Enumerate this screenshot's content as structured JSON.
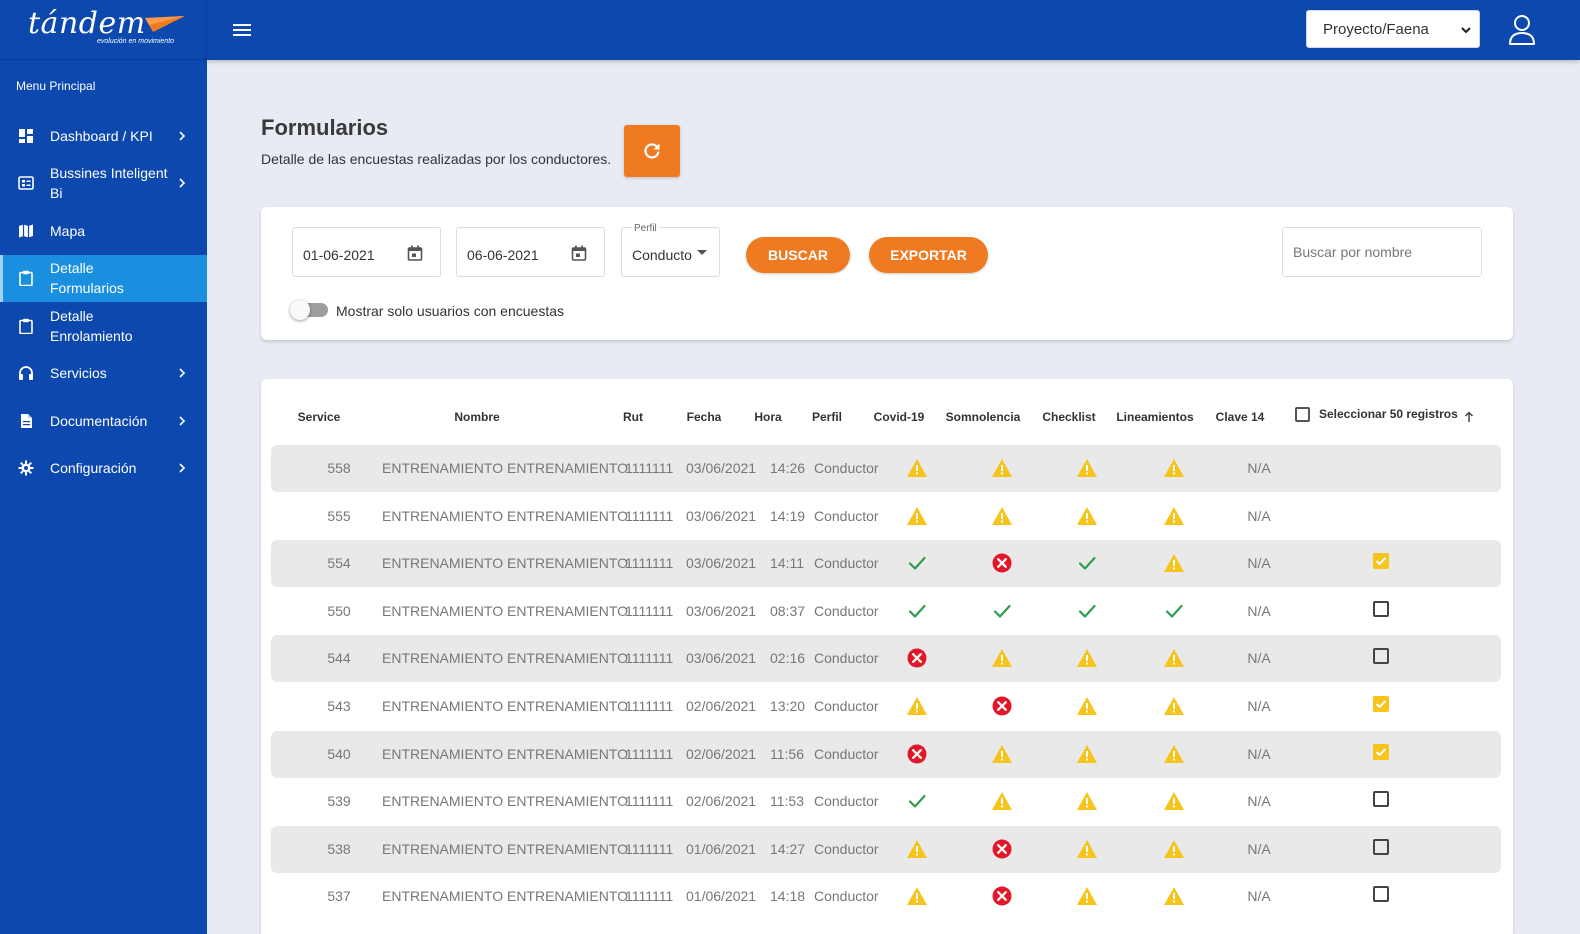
{
  "brand": {
    "logo_text": "tándem",
    "tagline": "evolución en movimiento"
  },
  "sidebar": {
    "title": "Menu Principal",
    "items": [
      {
        "label": "Dashboard / KPI",
        "icon": "dashboard-icon",
        "chevron": true,
        "active": false
      },
      {
        "label": "Bussines Inteligent Bi",
        "icon": "bi-icon",
        "chevron": true,
        "active": false
      },
      {
        "label": "Mapa",
        "icon": "map-icon",
        "chevron": false,
        "active": false
      },
      {
        "label": "Detalle Formularios",
        "icon": "clipboard-icon",
        "chevron": false,
        "active": true
      },
      {
        "label": "Detalle Enrolamiento",
        "icon": "clipboard-icon",
        "chevron": false,
        "active": false
      },
      {
        "label": "Servicios",
        "icon": "headset-icon",
        "chevron": true,
        "active": false
      },
      {
        "label": "Documentación",
        "icon": "document-icon",
        "chevron": true,
        "active": false
      },
      {
        "label": "Configuración",
        "icon": "gear-icon",
        "chevron": true,
        "active": false
      }
    ]
  },
  "topbar": {
    "project_select": "Proyecto/Faena"
  },
  "header": {
    "title": "Formularios",
    "subtitle": "Detalle de las encuestas realizadas por los conductores."
  },
  "filters": {
    "date_from": "01-06-2021",
    "date_to": "06-06-2021",
    "perfil_label": "Perfil",
    "perfil_value": "Conductor",
    "buscar_label": "BUSCAR",
    "exportar_label": "EXPORTAR",
    "search_placeholder": "Buscar por nombre",
    "toggle_label": "Mostrar solo usuarios con encuestas",
    "toggle_on": false
  },
  "colors": {
    "primary": "#0c48ad",
    "active": "#1a8fe0",
    "accent": "#f07a22",
    "warning": "#f6c41a",
    "error": "#e0182a",
    "ok": "#2e9c4c"
  },
  "table": {
    "headers": {
      "service": "Service",
      "nombre": "Nombre",
      "rut": "Rut",
      "fecha": "Fecha",
      "hora": "Hora",
      "perfil": "Perfil",
      "covid": "Covid-19",
      "somnolencia": "Somnolencia",
      "checklist": "Checklist",
      "lineamientos": "Lineamientos",
      "clave": "Clave 14",
      "select_all": "Seleccionar 50 registros"
    },
    "rows": [
      {
        "service": "558",
        "nombre": "ENTRENAMIENTO ENTRENAMIENTO",
        "rut": "1111111",
        "fecha": "03/06/2021",
        "hora": "14:26",
        "perfil": "Conductor",
        "covid": "warn",
        "somnolencia": "warn",
        "checklist": "warn",
        "lineamientos": "warn",
        "clave": "N/A",
        "select": "none"
      },
      {
        "service": "555",
        "nombre": "ENTRENAMIENTO ENTRENAMIENTO",
        "rut": "1111111",
        "fecha": "03/06/2021",
        "hora": "14:19",
        "perfil": "Conductor",
        "covid": "warn",
        "somnolencia": "warn",
        "checklist": "warn",
        "lineamientos": "warn",
        "clave": "N/A",
        "select": "none"
      },
      {
        "service": "554",
        "nombre": "ENTRENAMIENTO ENTRENAMIENTO",
        "rut": "1111111",
        "fecha": "03/06/2021",
        "hora": "14:11",
        "perfil": "Conductor",
        "covid": "ok",
        "somnolencia": "error",
        "checklist": "ok",
        "lineamientos": "warn",
        "clave": "N/A",
        "select": "checked"
      },
      {
        "service": "550",
        "nombre": "ENTRENAMIENTO ENTRENAMIENTO",
        "rut": "1111111",
        "fecha": "03/06/2021",
        "hora": "08:37",
        "perfil": "Conductor",
        "covid": "ok",
        "somnolencia": "ok",
        "checklist": "ok",
        "lineamientos": "ok",
        "clave": "N/A",
        "select": "empty"
      },
      {
        "service": "544",
        "nombre": "ENTRENAMIENTO ENTRENAMIENTO",
        "rut": "1111111",
        "fecha": "03/06/2021",
        "hora": "02:16",
        "perfil": "Conductor",
        "covid": "error",
        "somnolencia": "warn",
        "checklist": "warn",
        "lineamientos": "warn",
        "clave": "N/A",
        "select": "empty"
      },
      {
        "service": "543",
        "nombre": "ENTRENAMIENTO ENTRENAMIENTO",
        "rut": "1111111",
        "fecha": "02/06/2021",
        "hora": "13:20",
        "perfil": "Conductor",
        "covid": "warn",
        "somnolencia": "error",
        "checklist": "warn",
        "lineamientos": "warn",
        "clave": "N/A",
        "select": "checked"
      },
      {
        "service": "540",
        "nombre": "ENTRENAMIENTO ENTRENAMIENTO",
        "rut": "1111111",
        "fecha": "02/06/2021",
        "hora": "11:56",
        "perfil": "Conductor",
        "covid": "error",
        "somnolencia": "warn",
        "checklist": "warn",
        "lineamientos": "warn",
        "clave": "N/A",
        "select": "checked"
      },
      {
        "service": "539",
        "nombre": "ENTRENAMIENTO ENTRENAMIENTO",
        "rut": "1111111",
        "fecha": "02/06/2021",
        "hora": "11:53",
        "perfil": "Conductor",
        "covid": "ok",
        "somnolencia": "warn",
        "checklist": "warn",
        "lineamientos": "warn",
        "clave": "N/A",
        "select": "empty"
      },
      {
        "service": "538",
        "nombre": "ENTRENAMIENTO ENTRENAMIENTO",
        "rut": "1111111",
        "fecha": "01/06/2021",
        "hora": "14:27",
        "perfil": "Conductor",
        "covid": "warn",
        "somnolencia": "error",
        "checklist": "warn",
        "lineamientos": "warn",
        "clave": "N/A",
        "select": "empty"
      },
      {
        "service": "537",
        "nombre": "ENTRENAMIENTO ENTRENAMIENTO",
        "rut": "1111111",
        "fecha": "01/06/2021",
        "hora": "14:18",
        "perfil": "Conductor",
        "covid": "warn",
        "somnolencia": "error",
        "checklist": "warn",
        "lineamientos": "warn",
        "clave": "N/A",
        "select": "empty"
      }
    ]
  }
}
